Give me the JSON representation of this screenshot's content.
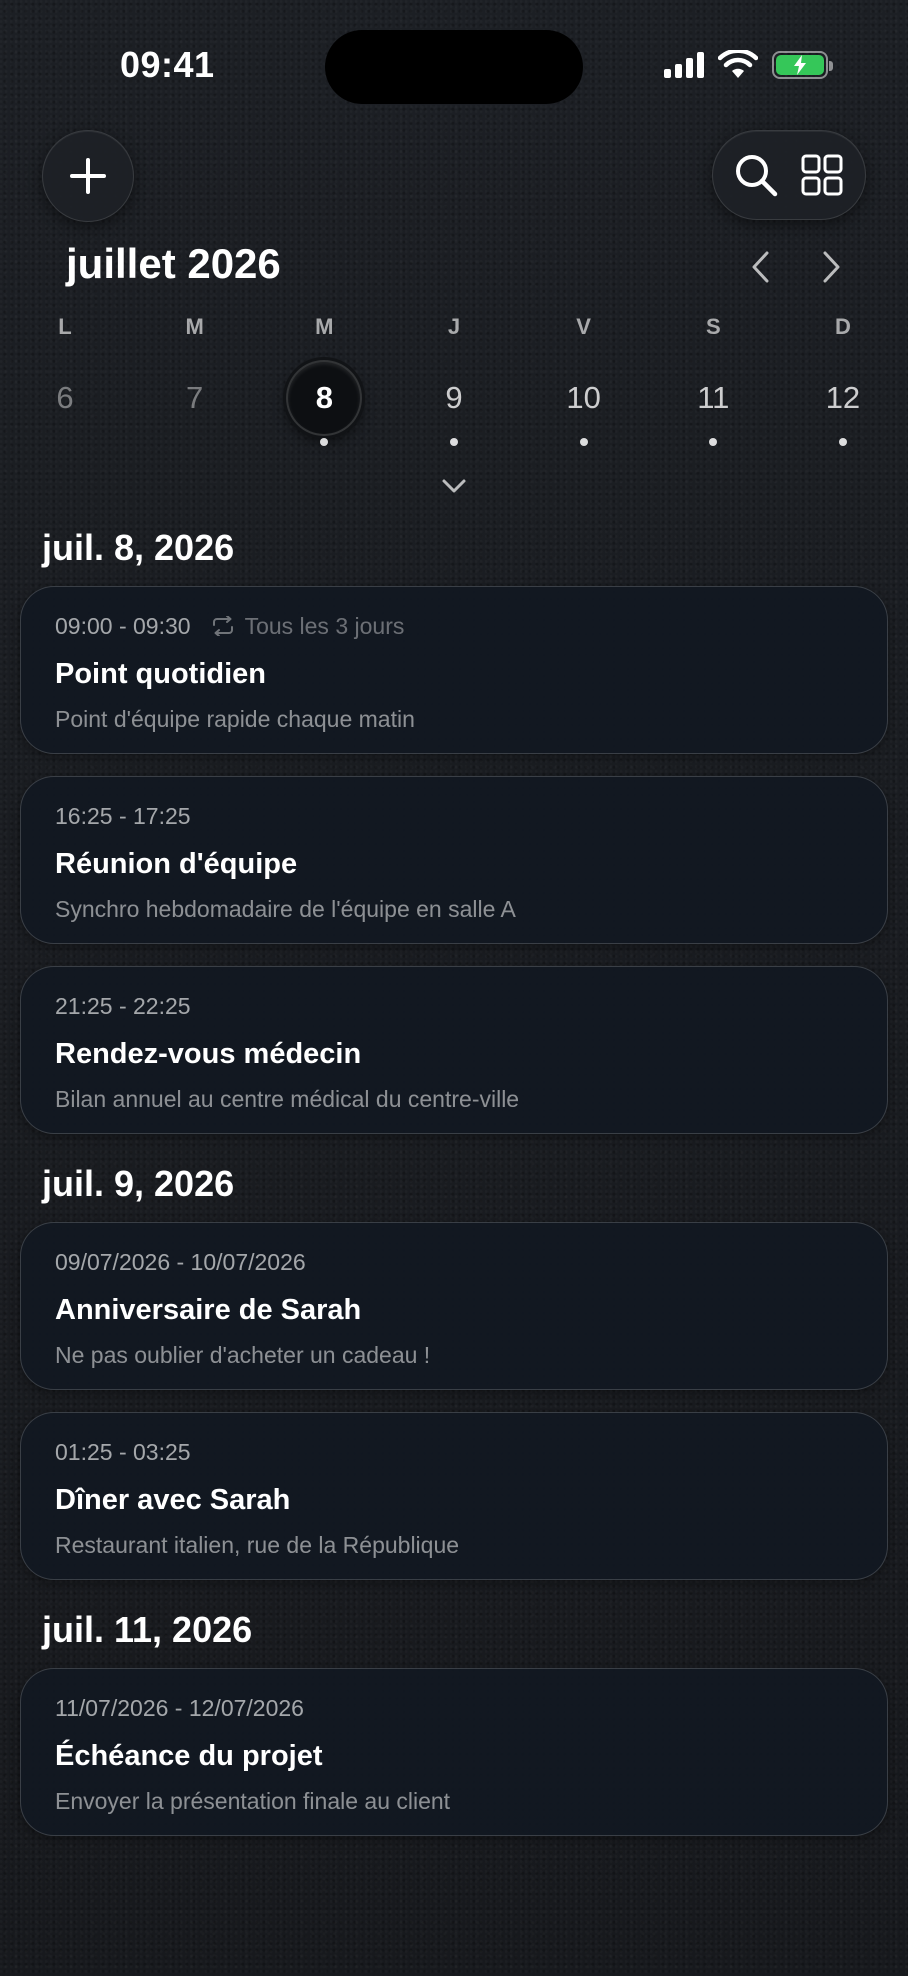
{
  "status_bar": {
    "time": "09:41",
    "battery_color": "#35c759"
  },
  "toolbar": {
    "add_icon": "plus-icon",
    "search_icon": "search-icon",
    "view_icon": "grid-icon"
  },
  "calendar": {
    "month_title": "juillet 2026",
    "weekdays": [
      "L",
      "M",
      "M",
      "J",
      "V",
      "S",
      "D"
    ],
    "days": [
      {
        "num": "6",
        "has_event": false,
        "state": "past"
      },
      {
        "num": "7",
        "has_event": false,
        "state": "past"
      },
      {
        "num": "8",
        "has_event": true,
        "state": "selected"
      },
      {
        "num": "9",
        "has_event": true,
        "state": "normal"
      },
      {
        "num": "10",
        "has_event": true,
        "state": "normal"
      },
      {
        "num": "11",
        "has_event": true,
        "state": "normal"
      },
      {
        "num": "12",
        "has_event": true,
        "state": "normal"
      }
    ]
  },
  "sections": [
    {
      "date": "juil. 8, 2026",
      "events": [
        {
          "time": "09:00 - 09:30",
          "repeat": "Tous les 3 jours",
          "title": "Point quotidien",
          "description": "Point d'équipe rapide chaque matin"
        },
        {
          "time": "16:25 - 17:25",
          "title": "Réunion d'équipe",
          "description": "Synchro hebdomadaire de l'équipe en salle A"
        },
        {
          "time": "21:25 - 22:25",
          "title": "Rendez-vous médecin",
          "description": "Bilan annuel au centre médical du centre-ville"
        }
      ]
    },
    {
      "date": "juil. 9, 2026",
      "events": [
        {
          "time": "09/07/2026 - 10/07/2026",
          "title": "Anniversaire de Sarah",
          "description": "Ne pas oublier d'acheter un cadeau !"
        },
        {
          "time": "01:25 - 03:25",
          "title": "Dîner avec Sarah",
          "description": "Restaurant italien, rue de la République"
        }
      ]
    },
    {
      "date": "juil. 11, 2026",
      "events": [
        {
          "time": "11/07/2026 - 12/07/2026",
          "title": "Échéance du projet",
          "description": "Envoyer la présentation finale au client"
        }
      ]
    }
  ]
}
